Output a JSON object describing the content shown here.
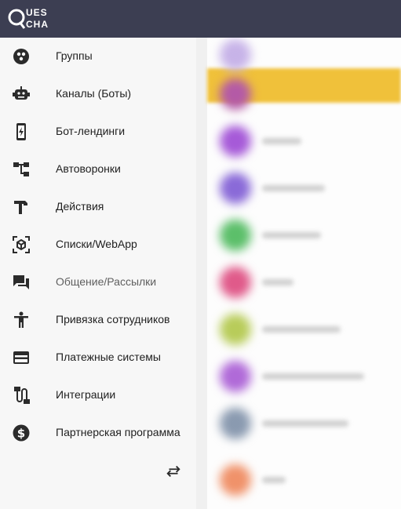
{
  "app": {
    "logo_line1": "UES",
    "logo_line2": "CHA"
  },
  "sidebar": {
    "items": [
      {
        "label": "Группы",
        "icon": "groups-icon"
      },
      {
        "label": "Каналы (Боты)",
        "icon": "robot-icon"
      },
      {
        "label": "Бот-лендинги",
        "icon": "phone-bolt-icon"
      },
      {
        "label": "Автоворонки",
        "icon": "flow-tree-icon"
      },
      {
        "label": "Действия",
        "icon": "hammer-icon"
      },
      {
        "label": "Списки/WebApp",
        "icon": "view-in-ar-icon"
      },
      {
        "label": "Общение/Рассылки",
        "icon": "chat-bubbles-icon"
      },
      {
        "label": "Привязка сотрудников",
        "icon": "person-accessibility-icon"
      },
      {
        "label": "Платежные системы",
        "icon": "credit-card-icon"
      },
      {
        "label": "Интеграции",
        "icon": "cable-icon"
      },
      {
        "label": "Партнерская программа",
        "icon": "dollar-circle-icon"
      }
    ],
    "collapse_icon": "swap-horiz-icon"
  },
  "colors": {
    "topbar": "#3c3e52",
    "sidebar_bg": "#f7f7f7",
    "highlight": "#f0c13a"
  }
}
